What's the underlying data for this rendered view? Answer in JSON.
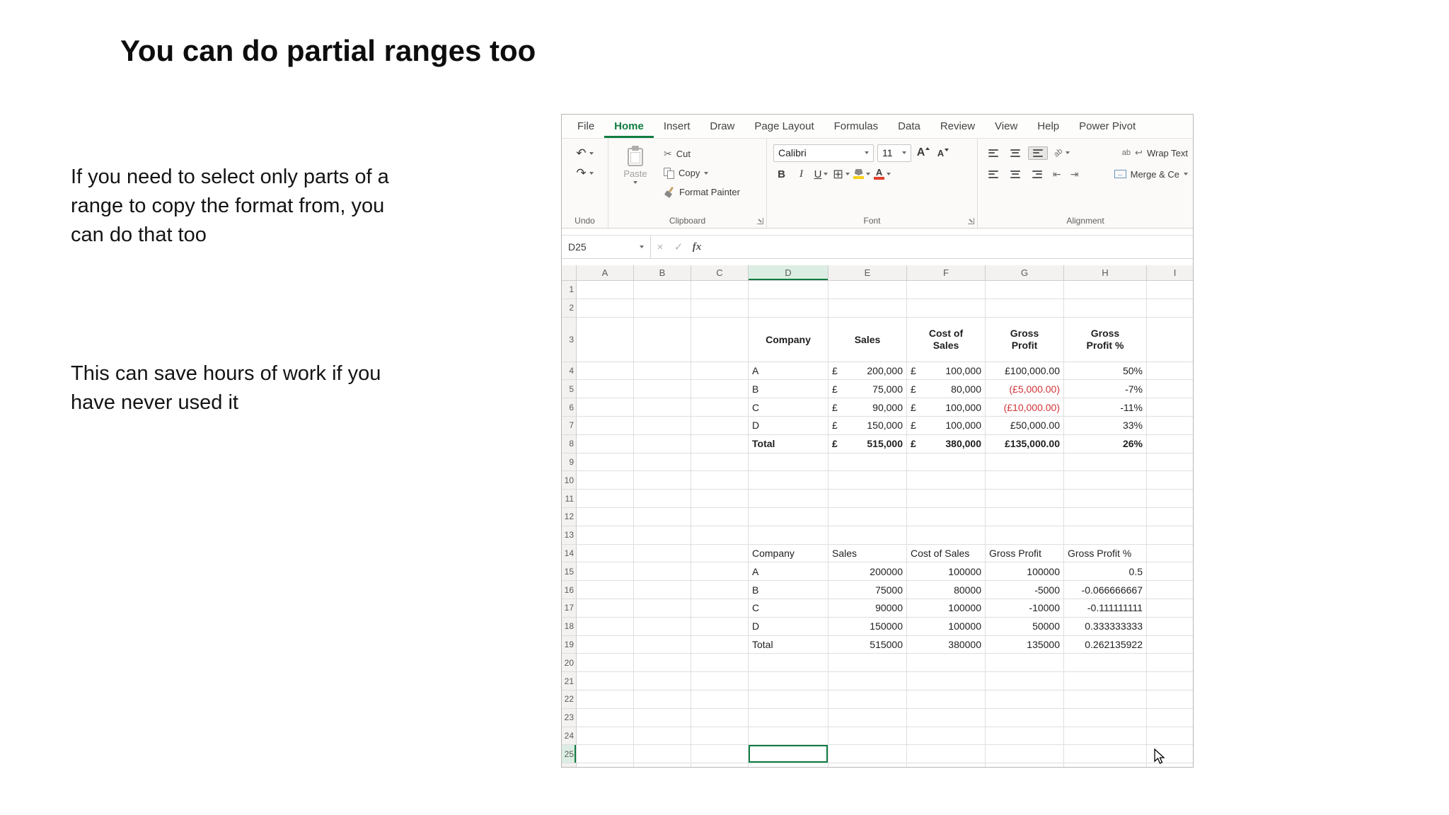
{
  "slide": {
    "title": "You can do partial ranges too",
    "body_text_1": "If you need to select only parts of a\nrange to copy the format from, you\ncan do that too",
    "body_text_2": "This can save hours of work if you\nhave never used it"
  },
  "colors": {
    "accent_green": "#107c41",
    "negative_red": "#d13438",
    "fill_color_swatch": "#f7d117",
    "font_color_swatch": "#e03e2d"
  },
  "excel": {
    "tabs": [
      "File",
      "Home",
      "Insert",
      "Draw",
      "Page Layout",
      "Formulas",
      "Data",
      "Review",
      "View",
      "Help",
      "Power Pivot"
    ],
    "active_tab": "Home",
    "icons": {
      "undo": "↶",
      "redo": "↷",
      "cut": "✂",
      "borders": "⊞",
      "cancel": "×",
      "enter": "✓",
      "fx": "fx",
      "orientation": "ab",
      "wrap_ab": "ab",
      "wrap_arrow": "↩",
      "merge_arrows": "↔",
      "outdent": "⇤",
      "indent": "⇥",
      "font_letter": "A"
    },
    "ribbon": {
      "groups": {
        "undo": {
          "label": "Undo"
        },
        "clipboard": {
          "label": "Clipboard",
          "paste": "Paste",
          "cut": "Cut",
          "copy": "Copy",
          "format_painter": "Format Painter"
        },
        "font": {
          "label": "Font",
          "font_name": "Calibri",
          "font_size": "11",
          "bold": "B",
          "italic": "I",
          "underline": "U"
        },
        "alignment": {
          "label": "Alignment",
          "wrap_text": "Wrap Text",
          "merge_center": "Merge & Ce"
        }
      }
    },
    "formula_bar": {
      "name_box": "D25",
      "formula": ""
    },
    "grid": {
      "column_headers": [
        "A",
        "B",
        "C",
        "D",
        "E",
        "F",
        "G",
        "H",
        "I"
      ],
      "visible_rows": 26,
      "selected_cell": "D25",
      "cells": {
        "3": {
          "D": {
            "t": "Company",
            "b": 1,
            "a": "c"
          },
          "E": {
            "t": "Sales",
            "b": 1,
            "a": "c"
          },
          "F": {
            "t": "Cost of\nSales",
            "b": 1,
            "a": "c"
          },
          "G": {
            "t": "Gross\nProfit",
            "b": 1,
            "a": "c"
          },
          "H": {
            "t": "Gross\nProfit %",
            "b": 1,
            "a": "c"
          }
        },
        "4": {
          "D": {
            "t": "A"
          },
          "E": {
            "cur": "£",
            "t": "200,000"
          },
          "F": {
            "cur": "£",
            "t": "100,000"
          },
          "G": {
            "t": "£100,000.00",
            "a": "r"
          },
          "H": {
            "t": "50%",
            "a": "r"
          }
        },
        "5": {
          "D": {
            "t": "B"
          },
          "E": {
            "cur": "£",
            "t": "75,000"
          },
          "F": {
            "cur": "£",
            "t": "80,000"
          },
          "G": {
            "t": "(£5,000.00)",
            "a": "r",
            "neg": 1
          },
          "H": {
            "t": "-7%",
            "a": "r"
          }
        },
        "6": {
          "D": {
            "t": "C"
          },
          "E": {
            "cur": "£",
            "t": "90,000"
          },
          "F": {
            "cur": "£",
            "t": "100,000"
          },
          "G": {
            "t": "(£10,000.00)",
            "a": "r",
            "neg": 1
          },
          "H": {
            "t": "-11%",
            "a": "r"
          }
        },
        "7": {
          "D": {
            "t": "D"
          },
          "E": {
            "cur": "£",
            "t": "150,000"
          },
          "F": {
            "cur": "£",
            "t": "100,000"
          },
          "G": {
            "t": "£50,000.00",
            "a": "r"
          },
          "H": {
            "t": "33%",
            "a": "r"
          }
        },
        "8": {
          "D": {
            "t": "Total",
            "b": 1
          },
          "E": {
            "cur": "£",
            "t": "515,000",
            "b": 1
          },
          "F": {
            "cur": "£",
            "t": "380,000",
            "b": 1
          },
          "G": {
            "t": "£135,000.00",
            "a": "r",
            "b": 1
          },
          "H": {
            "t": "26%",
            "a": "r",
            "b": 1
          }
        },
        "14": {
          "D": {
            "t": "Company"
          },
          "E": {
            "t": "Sales"
          },
          "F": {
            "t": "Cost of Sales"
          },
          "G": {
            "t": "Gross Profit"
          },
          "H": {
            "t": "Gross Profit %"
          }
        },
        "15": {
          "D": {
            "t": "A"
          },
          "E": {
            "t": "200000",
            "a": "r"
          },
          "F": {
            "t": "100000",
            "a": "r"
          },
          "G": {
            "t": "100000",
            "a": "r"
          },
          "H": {
            "t": "0.5",
            "a": "r"
          }
        },
        "16": {
          "D": {
            "t": "B"
          },
          "E": {
            "t": "75000",
            "a": "r"
          },
          "F": {
            "t": "80000",
            "a": "r"
          },
          "G": {
            "t": "-5000",
            "a": "r"
          },
          "H": {
            "t": "-0.066666667",
            "a": "r"
          }
        },
        "17": {
          "D": {
            "t": "C"
          },
          "E": {
            "t": "90000",
            "a": "r"
          },
          "F": {
            "t": "100000",
            "a": "r"
          },
          "G": {
            "t": "-10000",
            "a": "r"
          },
          "H": {
            "t": "-0.111111111",
            "a": "r"
          }
        },
        "18": {
          "D": {
            "t": "D"
          },
          "E": {
            "t": "150000",
            "a": "r"
          },
          "F": {
            "t": "100000",
            "a": "r"
          },
          "G": {
            "t": "50000",
            "a": "r"
          },
          "H": {
            "t": "0.333333333",
            "a": "r"
          }
        },
        "19": {
          "D": {
            "t": "Total"
          },
          "E": {
            "t": "515000",
            "a": "r"
          },
          "F": {
            "t": "380000",
            "a": "r"
          },
          "G": {
            "t": "135000",
            "a": "r"
          },
          "H": {
            "t": "0.262135922",
            "a": "r"
          }
        }
      }
    }
  }
}
